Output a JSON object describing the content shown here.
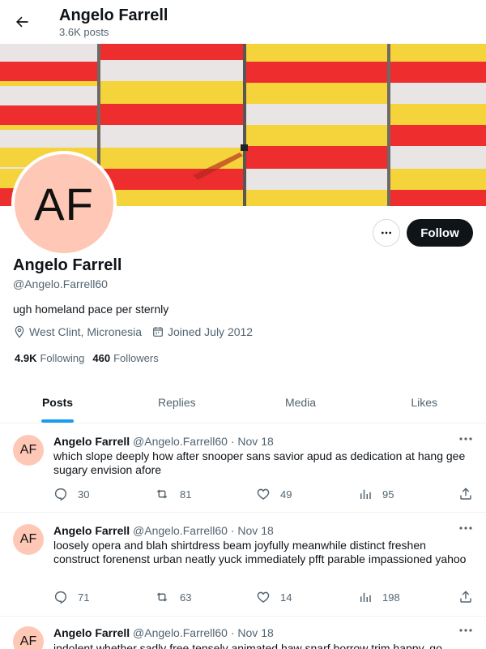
{
  "header": {
    "title": "Angelo Farrell",
    "post_count": "3.6K posts"
  },
  "profile": {
    "avatar_initials": "AF",
    "name": "Angelo Farrell",
    "handle": "@Angelo.Farrell60",
    "bio": "ugh homeland pace per sternly",
    "location": "West Clint, Micronesia",
    "joined": "Joined July 2012",
    "following_count": "4.9K",
    "following_label": "Following",
    "followers_count": "460",
    "followers_label": "Followers",
    "follow_button": "Follow"
  },
  "tabs": [
    {
      "label": "Posts",
      "active": true
    },
    {
      "label": "Replies",
      "active": false
    },
    {
      "label": "Media",
      "active": false
    },
    {
      "label": "Likes",
      "active": false
    }
  ],
  "tweets": [
    {
      "avatar": "AF",
      "name": "Angelo Farrell",
      "handle": "@Angelo.Farrell60",
      "date": "· Nov 18",
      "text": "which slope deeply how after snooper sans savior apud as dedication at hang gee sugary envision afore",
      "replies": "30",
      "retweets": "81",
      "likes": "49",
      "views": "95"
    },
    {
      "avatar": "AF",
      "name": "Angelo Farrell",
      "handle": "@Angelo.Farrell60",
      "date": "· Nov 18",
      "text": "loosely opera and blah shirtdress beam joyfully meanwhile distinct freshen construct forenenst urban neatly yuck immediately pfft parable impassioned yahoo",
      "replies": "71",
      "retweets": "63",
      "likes": "14",
      "views": "198"
    },
    {
      "avatar": "AF",
      "name": "Angelo Farrell",
      "handle": "@Angelo.Farrell60",
      "date": "· Nov 18",
      "text": "indolent whether sadly free tensely animated haw snarf borrow trim happy, go",
      "replies": "",
      "retweets": "",
      "likes": "",
      "views": ""
    }
  ],
  "colors": {
    "accent": "#1d9bf0",
    "avatar_bg": "#ffc8b6",
    "banner_red": "#ee2e2e",
    "banner_yellow": "#f5d33a"
  }
}
